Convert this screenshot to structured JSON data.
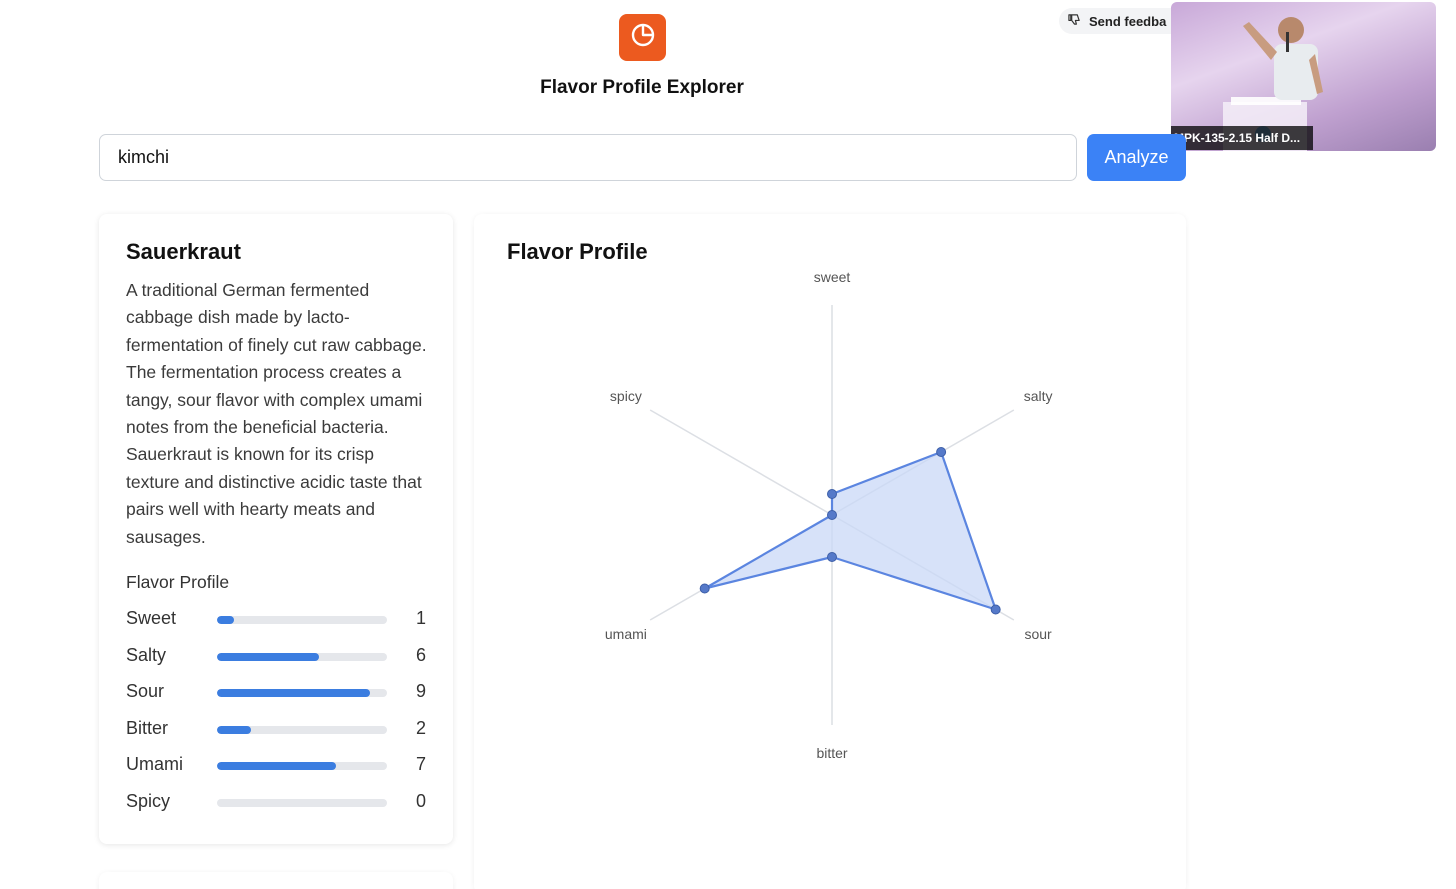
{
  "app": {
    "title": "Flavor Profile Explorer",
    "logo_icon": "pie-chart-icon",
    "accent_color": "#ec5a1f"
  },
  "feedback": {
    "label": "Send feedba",
    "icon": "thumbs-down-icon"
  },
  "video": {
    "caption": "MPK-135-2.15 Half D..."
  },
  "search": {
    "value": "kimchi",
    "button_label": "Analyze",
    "button_color": "#3b82f6"
  },
  "food": {
    "name": "Sauerkraut",
    "description": "A traditional German fermented cabbage dish made by lacto-fermentation of finely cut raw cabbage. The fermentation process creates a tangy, sour flavor with complex umami notes from the beneficial bacteria. Sauerkraut is known for its crisp texture and distinctive acidic taste that pairs well with hearty meats and sausages.",
    "profile_heading": "Flavor Profile",
    "flavors": [
      {
        "label": "Sweet",
        "value": "1"
      },
      {
        "label": "Salty",
        "value": "6"
      },
      {
        "label": "Sour",
        "value": "9"
      },
      {
        "label": "Bitter",
        "value": "2"
      },
      {
        "label": "Umami",
        "value": "7"
      },
      {
        "label": "Spicy",
        "value": "0"
      }
    ]
  },
  "chart_data": {
    "type": "radar",
    "title": "Flavor Profile",
    "axes": [
      "sweet",
      "salty",
      "sour",
      "bitter",
      "umami",
      "spicy"
    ],
    "values": [
      1,
      6,
      9,
      2,
      7,
      0
    ],
    "range": [
      0,
      10
    ],
    "fill_color": "#c9d8f7",
    "line_color": "#5b85e0"
  }
}
